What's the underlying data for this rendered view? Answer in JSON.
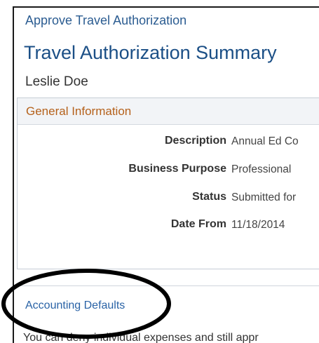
{
  "breadcrumb": "Approve Travel Authorization",
  "page_title": "Travel Authorization Summary",
  "person_name": "Leslie Doe",
  "general_information": {
    "title": "General Information",
    "fields": [
      {
        "label": "Description",
        "value": "Annual Ed Co"
      },
      {
        "label": "Business Purpose",
        "value": "Professional"
      },
      {
        "label": "Status",
        "value": "Submitted for"
      },
      {
        "label": "Date From",
        "value": "11/18/2014"
      }
    ]
  },
  "accounting_defaults_link": "Accounting Defaults",
  "bottom_text": "You can deny individual expenses and still appr",
  "annotation_color": "#000000",
  "colors": {
    "breadcrumb": "#2b5c91",
    "title": "#1b4f86",
    "section_title": "#b5611b",
    "link": "#2a63a6"
  }
}
